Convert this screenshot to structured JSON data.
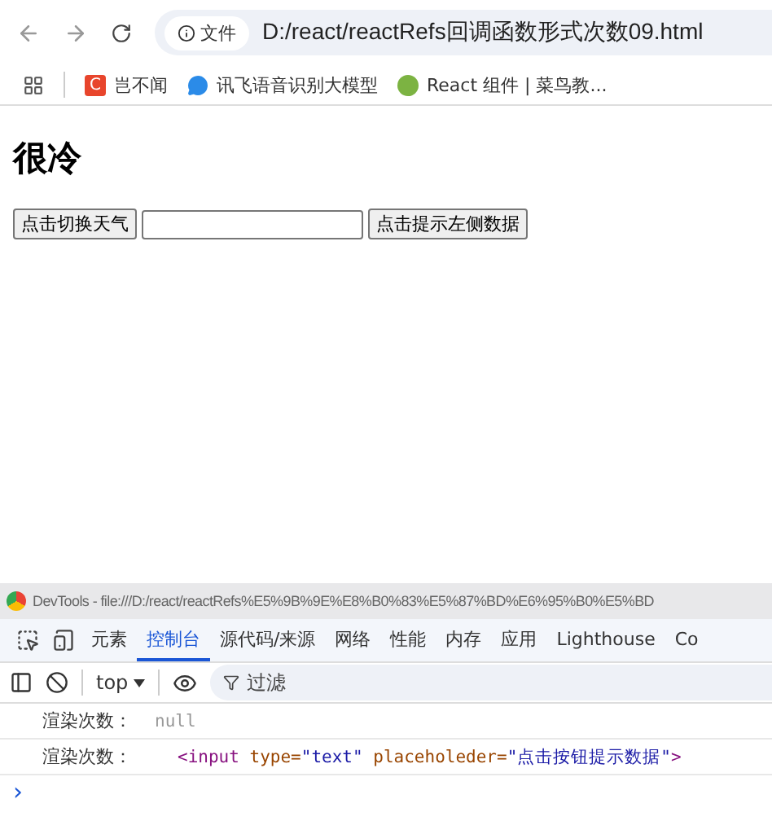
{
  "browser": {
    "address": {
      "badge": "文件",
      "url": "D:/react/reactRefs回调函数形式次数09.html"
    },
    "bookmarks": [
      {
        "label": "岂不闻",
        "kind": "letter",
        "glyph": "C"
      },
      {
        "label": "讯飞语音识别大模型",
        "kind": "chat"
      },
      {
        "label": "React 组件 | 菜鸟教...",
        "kind": "green"
      }
    ]
  },
  "page": {
    "heading": "很冷",
    "controls": [
      {
        "kind": "button",
        "label": "点击切换天气"
      },
      {
        "kind": "input"
      },
      {
        "kind": "button",
        "label": "点击提示左侧数据"
      }
    ]
  },
  "devtools": {
    "title": "DevTools - file:///D:/react/reactRefs%E5%9B%9E%E8%B0%83%E5%87%BD%E6%95%B0%E5%BD",
    "tabs": [
      {
        "label": "元素",
        "selected": false
      },
      {
        "label": "控制台",
        "selected": true
      },
      {
        "label": "源代码/来源",
        "selected": false
      },
      {
        "label": "网络",
        "selected": false
      },
      {
        "label": "性能",
        "selected": false
      },
      {
        "label": "内存",
        "selected": false
      },
      {
        "label": "应用",
        "selected": false
      },
      {
        "label": "Lighthouse",
        "selected": false
      },
      {
        "label": "Co",
        "selected": false
      }
    ],
    "context": "top",
    "filter_placeholder": "过滤",
    "messages": [
      {
        "label": "渲染次数：",
        "parts": [
          {
            "kind": "null",
            "text": "null"
          }
        ]
      },
      {
        "label": "渲染次数：",
        "parts": [
          {
            "kind": "tag",
            "text": "<input"
          },
          {
            "kind": "attr",
            "text": "type="
          },
          {
            "kind": "value",
            "text": "\"text\""
          },
          {
            "kind": "attr",
            "text": "placeholeder="
          },
          {
            "kind": "value",
            "text": "\"点击按钮提示数据\""
          },
          {
            "kind": "tag",
            "text": ">"
          }
        ]
      }
    ],
    "prompt": "›"
  }
}
